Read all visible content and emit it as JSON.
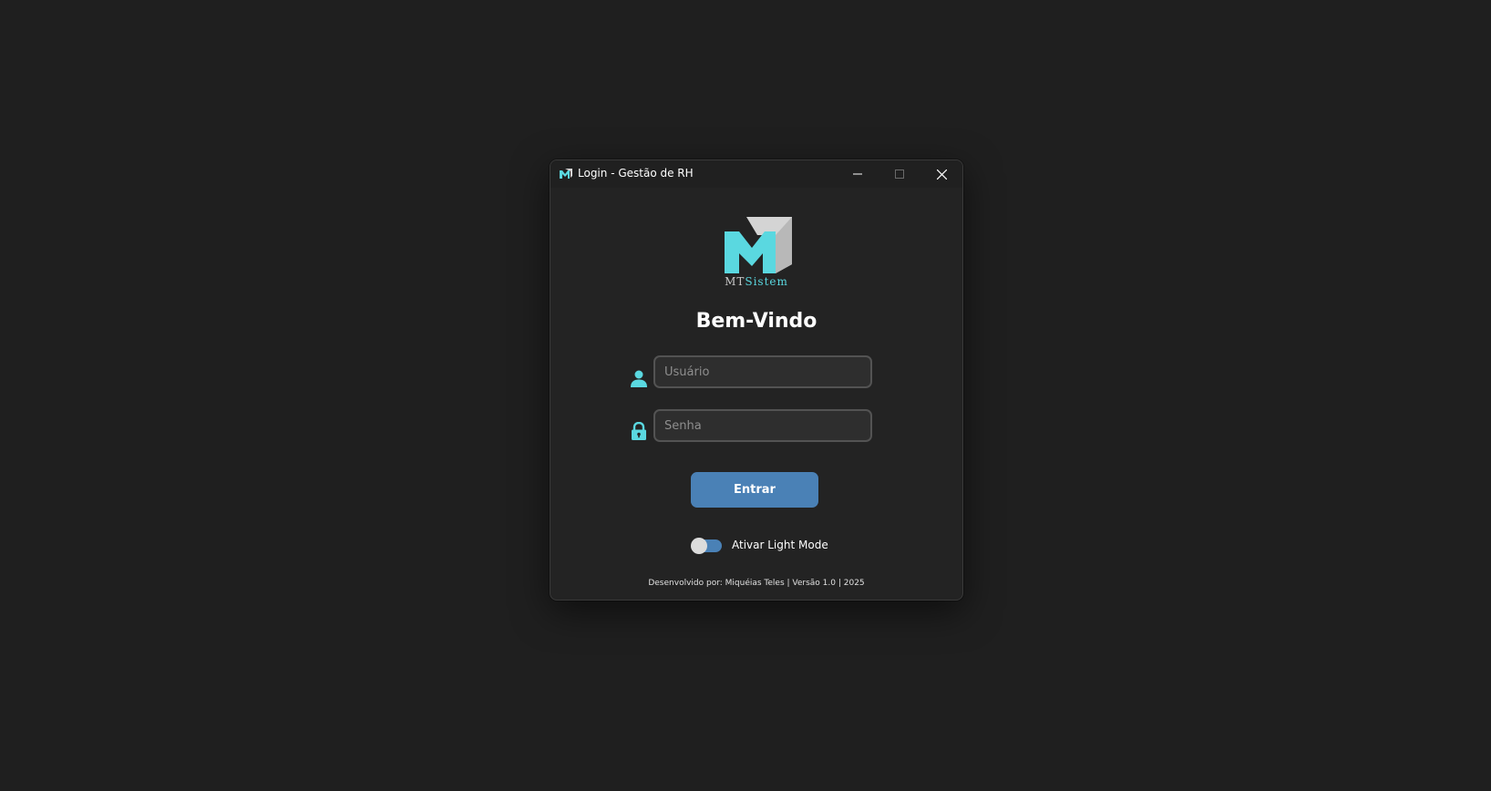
{
  "window": {
    "title": "Login - Gestão de RH",
    "controls": {
      "minimize_icon": "minimize-icon",
      "maximize_icon": "maximize-icon",
      "close_icon": "close-icon"
    }
  },
  "logo": {
    "text_primary": "MT",
    "text_accent": "Sistem",
    "icon": "mtsistem-logo-icon"
  },
  "welcome": "Bem-Vindo",
  "form": {
    "username": {
      "icon": "user-icon",
      "placeholder": "Usuário",
      "value": ""
    },
    "password": {
      "icon": "lock-icon",
      "placeholder": "Senha",
      "value": ""
    },
    "submit_label": "Entrar"
  },
  "theme_toggle": {
    "label": "Ativar Light Mode",
    "checked": false
  },
  "footer": "Desenvolvido por: Miquéias Teles | Versão 1.0 | 2025",
  "colors": {
    "accent": "#5ad8e0",
    "button": "#4a81b6",
    "background": "#1f1f1f",
    "window": "#232323"
  }
}
